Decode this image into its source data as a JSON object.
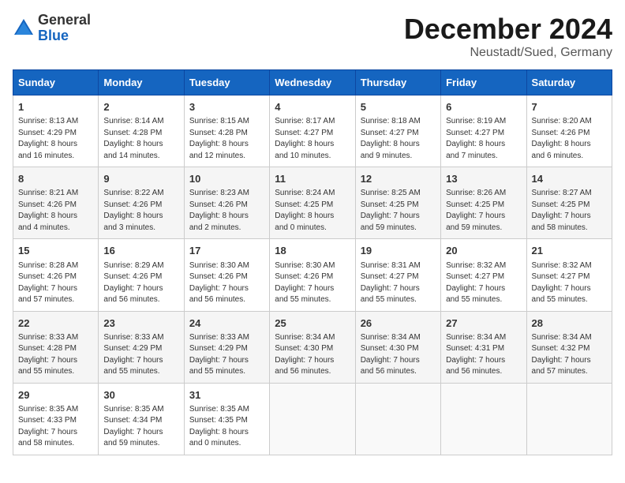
{
  "header": {
    "logo_line1": "General",
    "logo_line2": "Blue",
    "month": "December 2024",
    "location": "Neustadt/Sued, Germany"
  },
  "days_of_week": [
    "Sunday",
    "Monday",
    "Tuesday",
    "Wednesday",
    "Thursday",
    "Friday",
    "Saturday"
  ],
  "weeks": [
    [
      {
        "day": "1",
        "info": "Sunrise: 8:13 AM\nSunset: 4:29 PM\nDaylight: 8 hours\nand 16 minutes."
      },
      {
        "day": "2",
        "info": "Sunrise: 8:14 AM\nSunset: 4:28 PM\nDaylight: 8 hours\nand 14 minutes."
      },
      {
        "day": "3",
        "info": "Sunrise: 8:15 AM\nSunset: 4:28 PM\nDaylight: 8 hours\nand 12 minutes."
      },
      {
        "day": "4",
        "info": "Sunrise: 8:17 AM\nSunset: 4:27 PM\nDaylight: 8 hours\nand 10 minutes."
      },
      {
        "day": "5",
        "info": "Sunrise: 8:18 AM\nSunset: 4:27 PM\nDaylight: 8 hours\nand 9 minutes."
      },
      {
        "day": "6",
        "info": "Sunrise: 8:19 AM\nSunset: 4:27 PM\nDaylight: 8 hours\nand 7 minutes."
      },
      {
        "day": "7",
        "info": "Sunrise: 8:20 AM\nSunset: 4:26 PM\nDaylight: 8 hours\nand 6 minutes."
      }
    ],
    [
      {
        "day": "8",
        "info": "Sunrise: 8:21 AM\nSunset: 4:26 PM\nDaylight: 8 hours\nand 4 minutes."
      },
      {
        "day": "9",
        "info": "Sunrise: 8:22 AM\nSunset: 4:26 PM\nDaylight: 8 hours\nand 3 minutes."
      },
      {
        "day": "10",
        "info": "Sunrise: 8:23 AM\nSunset: 4:26 PM\nDaylight: 8 hours\nand 2 minutes."
      },
      {
        "day": "11",
        "info": "Sunrise: 8:24 AM\nSunset: 4:25 PM\nDaylight: 8 hours\nand 0 minutes."
      },
      {
        "day": "12",
        "info": "Sunrise: 8:25 AM\nSunset: 4:25 PM\nDaylight: 7 hours\nand 59 minutes."
      },
      {
        "day": "13",
        "info": "Sunrise: 8:26 AM\nSunset: 4:25 PM\nDaylight: 7 hours\nand 59 minutes."
      },
      {
        "day": "14",
        "info": "Sunrise: 8:27 AM\nSunset: 4:25 PM\nDaylight: 7 hours\nand 58 minutes."
      }
    ],
    [
      {
        "day": "15",
        "info": "Sunrise: 8:28 AM\nSunset: 4:26 PM\nDaylight: 7 hours\nand 57 minutes."
      },
      {
        "day": "16",
        "info": "Sunrise: 8:29 AM\nSunset: 4:26 PM\nDaylight: 7 hours\nand 56 minutes."
      },
      {
        "day": "17",
        "info": "Sunrise: 8:30 AM\nSunset: 4:26 PM\nDaylight: 7 hours\nand 56 minutes."
      },
      {
        "day": "18",
        "info": "Sunrise: 8:30 AM\nSunset: 4:26 PM\nDaylight: 7 hours\nand 55 minutes."
      },
      {
        "day": "19",
        "info": "Sunrise: 8:31 AM\nSunset: 4:27 PM\nDaylight: 7 hours\nand 55 minutes."
      },
      {
        "day": "20",
        "info": "Sunrise: 8:32 AM\nSunset: 4:27 PM\nDaylight: 7 hours\nand 55 minutes."
      },
      {
        "day": "21",
        "info": "Sunrise: 8:32 AM\nSunset: 4:27 PM\nDaylight: 7 hours\nand 55 minutes."
      }
    ],
    [
      {
        "day": "22",
        "info": "Sunrise: 8:33 AM\nSunset: 4:28 PM\nDaylight: 7 hours\nand 55 minutes."
      },
      {
        "day": "23",
        "info": "Sunrise: 8:33 AM\nSunset: 4:29 PM\nDaylight: 7 hours\nand 55 minutes."
      },
      {
        "day": "24",
        "info": "Sunrise: 8:33 AM\nSunset: 4:29 PM\nDaylight: 7 hours\nand 55 minutes."
      },
      {
        "day": "25",
        "info": "Sunrise: 8:34 AM\nSunset: 4:30 PM\nDaylight: 7 hours\nand 56 minutes."
      },
      {
        "day": "26",
        "info": "Sunrise: 8:34 AM\nSunset: 4:30 PM\nDaylight: 7 hours\nand 56 minutes."
      },
      {
        "day": "27",
        "info": "Sunrise: 8:34 AM\nSunset: 4:31 PM\nDaylight: 7 hours\nand 56 minutes."
      },
      {
        "day": "28",
        "info": "Sunrise: 8:34 AM\nSunset: 4:32 PM\nDaylight: 7 hours\nand 57 minutes."
      }
    ],
    [
      {
        "day": "29",
        "info": "Sunrise: 8:35 AM\nSunset: 4:33 PM\nDaylight: 7 hours\nand 58 minutes."
      },
      {
        "day": "30",
        "info": "Sunrise: 8:35 AM\nSunset: 4:34 PM\nDaylight: 7 hours\nand 59 minutes."
      },
      {
        "day": "31",
        "info": "Sunrise: 8:35 AM\nSunset: 4:35 PM\nDaylight: 8 hours\nand 0 minutes."
      },
      {
        "day": "",
        "info": ""
      },
      {
        "day": "",
        "info": ""
      },
      {
        "day": "",
        "info": ""
      },
      {
        "day": "",
        "info": ""
      }
    ]
  ]
}
